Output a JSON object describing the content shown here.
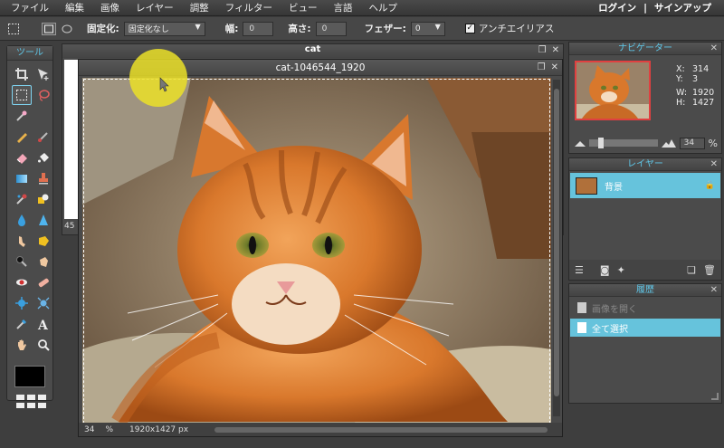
{
  "menu": {
    "items": [
      "ファイル",
      "編集",
      "画像",
      "レイヤー",
      "調整",
      "フィルター",
      "ビュー",
      "言語",
      "ヘルプ"
    ],
    "login": "ログイン",
    "separator": "|",
    "signup": "サインアップ"
  },
  "options": {
    "fixed_label": "固定化:",
    "fixed_value": "固定化なし",
    "width_label": "幅:",
    "width_value": "0",
    "height_label": "高さ:",
    "height_value": "0",
    "feather_label": "フェザー:",
    "feather_value": "0",
    "antialias_label": "アンチエイリアス",
    "antialias_checked": true
  },
  "tools": {
    "title": "ツール"
  },
  "back_document": {
    "title": "cat",
    "zoom": "45"
  },
  "document": {
    "title": "cat-1046544_1920",
    "zoom": "34",
    "zoom_unit": "%",
    "dimensions": "1920x1427 px"
  },
  "navigator": {
    "title": "ナビゲーター",
    "x_label": "X:",
    "x_value": "314",
    "y_label": "Y:",
    "y_value": "3",
    "w_label": "W:",
    "w_value": "1920",
    "h_label": "H:",
    "h_value": "1427",
    "zoom_value": "34",
    "zoom_unit": "%"
  },
  "layers": {
    "title": "レイヤー",
    "items": [
      {
        "name": "背景",
        "locked": true
      }
    ]
  },
  "history": {
    "title": "履歴",
    "items": [
      {
        "label": "画像を開く",
        "active": false
      },
      {
        "label": "全て選択",
        "active": true
      }
    ]
  },
  "colors": {
    "accent": "#5fc7e8",
    "selection": "#66c3dc",
    "cursor_highlight": "#ebe128"
  }
}
